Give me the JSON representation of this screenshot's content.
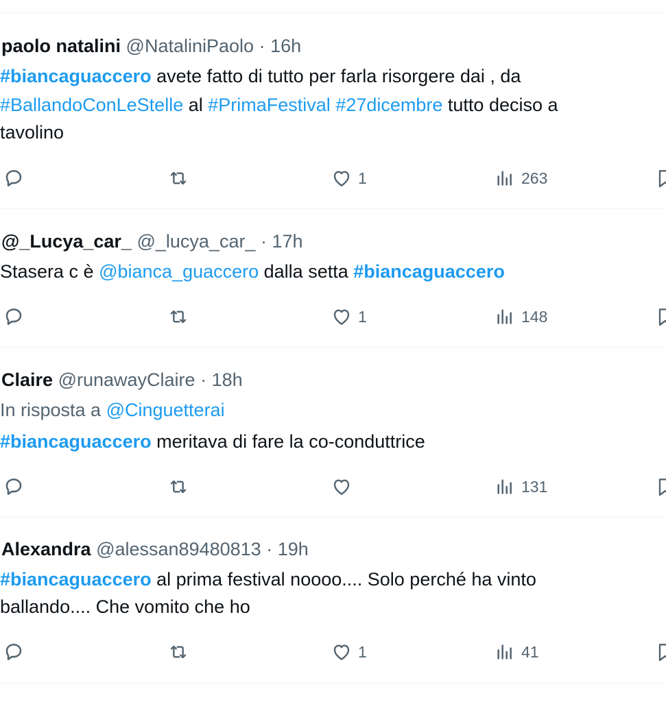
{
  "tweets": [
    {
      "name": "paolo natalini",
      "handle": "@NataliniPaolo",
      "separator": "·",
      "time": "16h",
      "lines": [
        [
          {
            "t": "#biancaguaccero",
            "k": "tag"
          },
          {
            "t": " avete fatto di tutto per farla risorgere dai , da",
            "k": "text"
          }
        ],
        [
          {
            "t": "#BallandoConLeStelle",
            "k": "link"
          },
          {
            "t": " al ",
            "k": "text"
          },
          {
            "t": "#PrimaFestival",
            "k": "link"
          },
          {
            "t": " ",
            "k": "text"
          },
          {
            "t": "#27dicembre",
            "k": "link"
          },
          {
            "t": " tutto deciso a",
            "k": "text"
          }
        ],
        [
          {
            "t": "tavolino",
            "k": "text"
          }
        ]
      ],
      "likes": "1",
      "views": "263"
    },
    {
      "name": "@_Lucya_car_",
      "handle": "@_lucya_car_",
      "separator": "·",
      "time": "17h",
      "lines": [
        [
          {
            "t": "Stasera c è ",
            "k": "text"
          },
          {
            "t": "@bianca_guaccero",
            "k": "link"
          },
          {
            "t": " dalla setta ",
            "k": "text"
          },
          {
            "t": "#biancaguaccero",
            "k": "tag"
          }
        ]
      ],
      "likes": "1",
      "views": "148"
    },
    {
      "name": "Claire",
      "handle": "@runawayClaire",
      "separator": "·",
      "time": "18h",
      "lines": [
        [
          {
            "t": "In risposta a ",
            "k": "muted"
          },
          {
            "t": "@Cinguetterai",
            "k": "link"
          }
        ],
        [
          {
            "t": "#biancaguaccero",
            "k": "tag"
          },
          {
            "t": " meritava di fare la co-conduttrice",
            "k": "text"
          }
        ]
      ],
      "likes": "",
      "views": "131"
    },
    {
      "name": "Alexandra",
      "handle": "@alessan89480813",
      "separator": "·",
      "time": "19h",
      "lines": [
        [
          {
            "t": "#biancaguaccero",
            "k": "tag"
          },
          {
            "t": " al prima festival noooo.... Solo perché ha vinto",
            "k": "text"
          }
        ],
        [
          {
            "t": "ballando.... Che vomito che ho",
            "k": "text"
          }
        ]
      ],
      "likes": "1",
      "views": "41"
    }
  ],
  "icons": {
    "reply": "reply-icon",
    "retweet": "retweet-icon",
    "like": "heart-icon",
    "views": "views-icon",
    "bookmark": "bookmark-icon"
  },
  "colors": {
    "link": "#1d9bf0",
    "text": "#0f1419",
    "muted": "#536471",
    "divider": "#eff3f4"
  }
}
